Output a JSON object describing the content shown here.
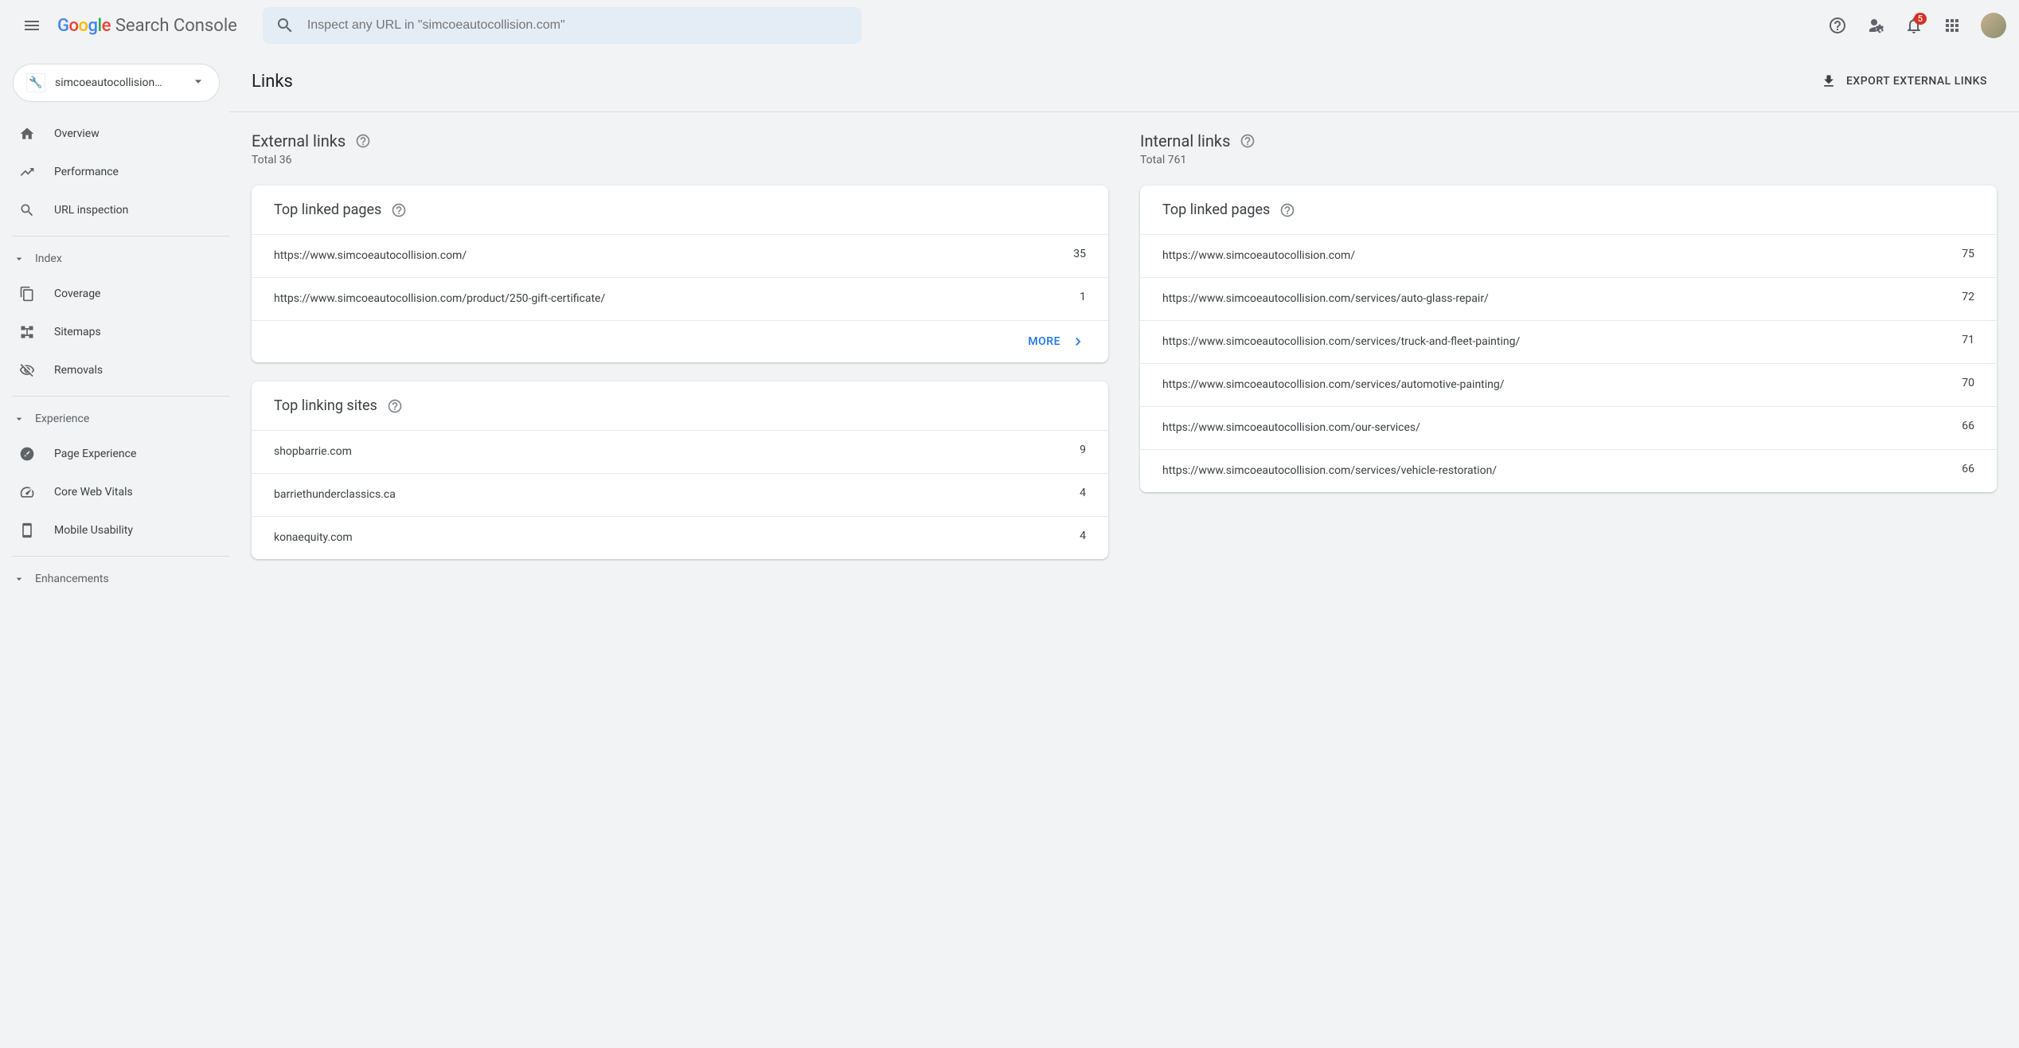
{
  "header": {
    "app_name": "Search Console",
    "search_placeholder": "Inspect any URL in \"simcoeautocollision.com\"",
    "notification_count": "5"
  },
  "sidebar": {
    "property_label": "simcoeautocollision…",
    "items_top": [
      {
        "label": "Overview"
      },
      {
        "label": "Performance"
      },
      {
        "label": "URL inspection"
      }
    ],
    "sections": [
      {
        "title": "Index",
        "items": [
          {
            "label": "Coverage"
          },
          {
            "label": "Sitemaps"
          },
          {
            "label": "Removals"
          }
        ]
      },
      {
        "title": "Experience",
        "items": [
          {
            "label": "Page Experience"
          },
          {
            "label": "Core Web Vitals"
          },
          {
            "label": "Mobile Usability"
          }
        ]
      },
      {
        "title": "Enhancements",
        "items": []
      }
    ]
  },
  "page": {
    "title": "Links",
    "export_label": "EXPORT EXTERNAL LINKS",
    "more_label": "MORE"
  },
  "external": {
    "title": "External links",
    "subtitle": "Total 36",
    "top_linked_pages": {
      "title": "Top linked pages",
      "rows": [
        {
          "url": "https://www.simcoeautocollision.com/",
          "count": "35"
        },
        {
          "url": "https://www.simcoeautocollision.com/product/250-gift-certificate/",
          "count": "1"
        }
      ]
    },
    "top_linking_sites": {
      "title": "Top linking sites",
      "rows": [
        {
          "url": "shopbarrie.com",
          "count": "9"
        },
        {
          "url": "barriethunderclassics.ca",
          "count": "4"
        },
        {
          "url": "konaequity.com",
          "count": "4"
        }
      ]
    }
  },
  "internal": {
    "title": "Internal links",
    "subtitle": "Total 761",
    "top_linked_pages": {
      "title": "Top linked pages",
      "rows": [
        {
          "url": "https://www.simcoeautocollision.com/",
          "count": "75"
        },
        {
          "url": "https://www.simcoeautocollision.com/services/auto-glass-repair/",
          "count": "72"
        },
        {
          "url": "https://www.simcoeautocollision.com/services/truck-and-fleet-painting/",
          "count": "71"
        },
        {
          "url": "https://www.simcoeautocollision.com/services/automotive-painting/",
          "count": "70"
        },
        {
          "url": "https://www.simcoeautocollision.com/our-services/",
          "count": "66"
        },
        {
          "url": "https://www.simcoeautocollision.com/services/vehicle-restoration/",
          "count": "66"
        }
      ]
    }
  }
}
